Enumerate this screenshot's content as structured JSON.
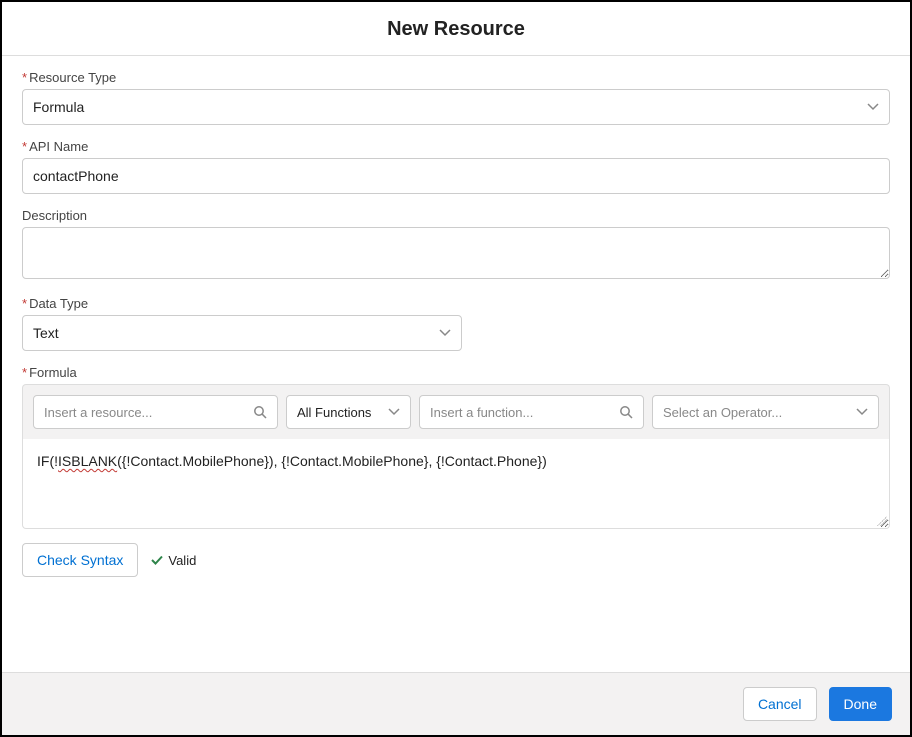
{
  "header": {
    "title": "New Resource"
  },
  "labels": {
    "resourceType": "Resource Type",
    "apiName": "API Name",
    "description": "Description",
    "dataType": "Data Type",
    "formula": "Formula"
  },
  "fields": {
    "resourceType": {
      "value": "Formula"
    },
    "apiName": {
      "value": "contactPhone"
    },
    "description": {
      "value": ""
    },
    "dataType": {
      "value": "Text"
    }
  },
  "formulaToolbar": {
    "resourcePlaceholder": "Insert a resource...",
    "functionsLabel": "All Functions",
    "functionPlaceholder": "Insert a function...",
    "operatorPlaceholder": "Select an Operator..."
  },
  "formula": {
    "prefix": "IF(!",
    "misspelled": "ISBLANK",
    "suffix": "({!Contact.MobilePhone}), {!Contact.MobilePhone}, {!Contact.Phone})"
  },
  "syntax": {
    "checkButton": "Check Syntax",
    "validLabel": "Valid"
  },
  "footer": {
    "cancel": "Cancel",
    "done": "Done"
  }
}
